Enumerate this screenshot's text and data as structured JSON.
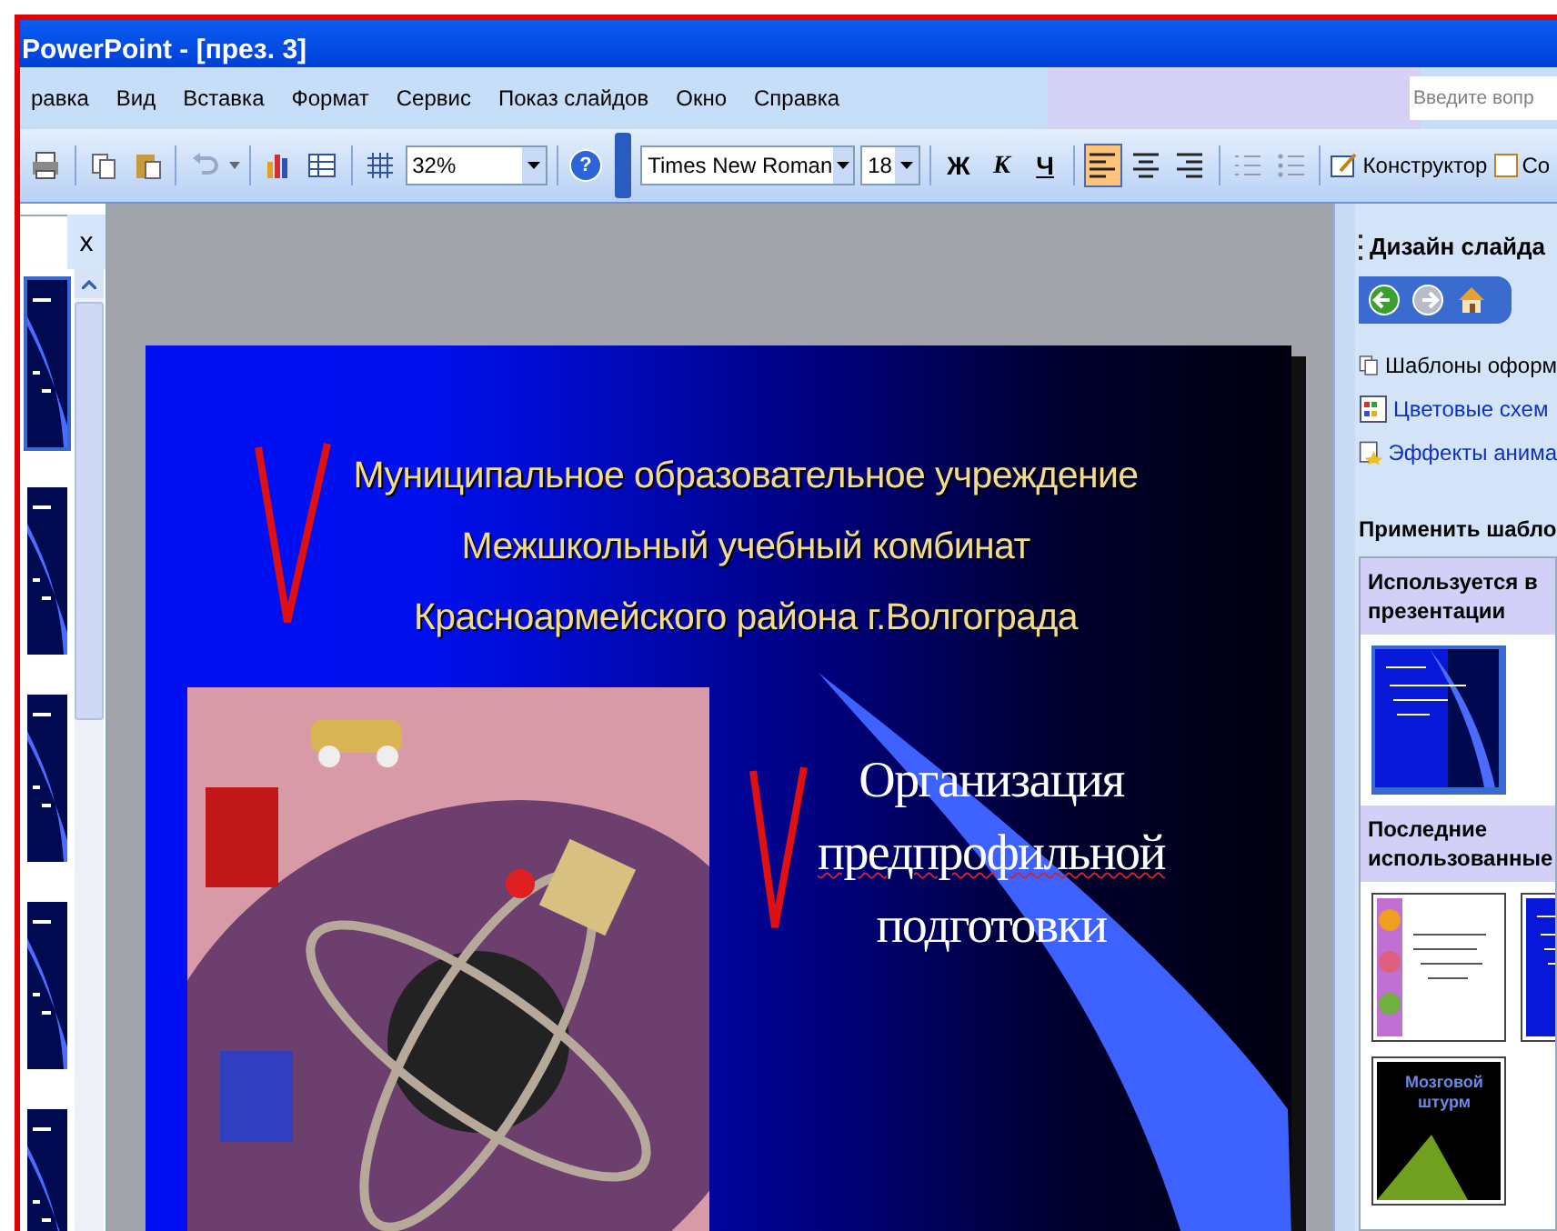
{
  "window": {
    "title": "PowerPoint - [през. 3]"
  },
  "menu": [
    "равка",
    "Вид",
    "Вставка",
    "Формат",
    "Сервис",
    "Показ слайдов",
    "Окно",
    "Справка"
  ],
  "help_search": {
    "placeholder": "Введите вопр"
  },
  "toolbar": {
    "zoom": "32%",
    "help": "?",
    "font": "Times New Roman",
    "font_size": "18",
    "format_buttons": [
      "Ж",
      "К",
      "Ч"
    ],
    "align_buttons": [
      {
        "selected": true
      },
      {
        "selected": false
      },
      {
        "selected": false
      }
    ],
    "design_button": "Конструктор",
    "cut_button": "Со"
  },
  "slides_panel": {
    "close": "x",
    "thumbnails": [
      {
        "selected": true
      },
      {
        "selected": false
      },
      {
        "selected": false
      },
      {
        "selected": false
      },
      {
        "selected": false
      }
    ]
  },
  "slide": {
    "title_lines": [
      "Муниципальное образовательное учреждение",
      "Межшкольный учебный комбинат",
      "Красноармейского района г.Волгограда"
    ],
    "subtitle_lines": [
      {
        "text": "Организация",
        "misspelled": false
      },
      {
        "text": "предпрофильной",
        "misspelled": true
      },
      {
        "text": "подготовки",
        "misspelled": false
      }
    ]
  },
  "task_pane": {
    "title": "Дизайн слайда",
    "nav": [
      {
        "kind": "back",
        "disabled": false
      },
      {
        "kind": "forward",
        "disabled": true
      },
      {
        "kind": "home",
        "disabled": false
      }
    ],
    "links": [
      "Шаблоны оформ",
      "Цветовые схем",
      "Эффекты анима"
    ],
    "apply_label": "Применить шабло",
    "sections": [
      {
        "title_lines": [
          "Используется в",
          "презентации"
        ],
        "thumbnails": [
          {
            "kind": "blue",
            "selected": true
          }
        ]
      },
      {
        "title_lines": [
          "Последние",
          "использованные"
        ],
        "thumbnails": [
          {
            "kind": "flowers",
            "selected": false
          },
          {
            "kind": "blue",
            "selected": false
          },
          {
            "kind": "dark",
            "text": "Мозговой штурм",
            "selected": false
          }
        ]
      }
    ]
  }
}
